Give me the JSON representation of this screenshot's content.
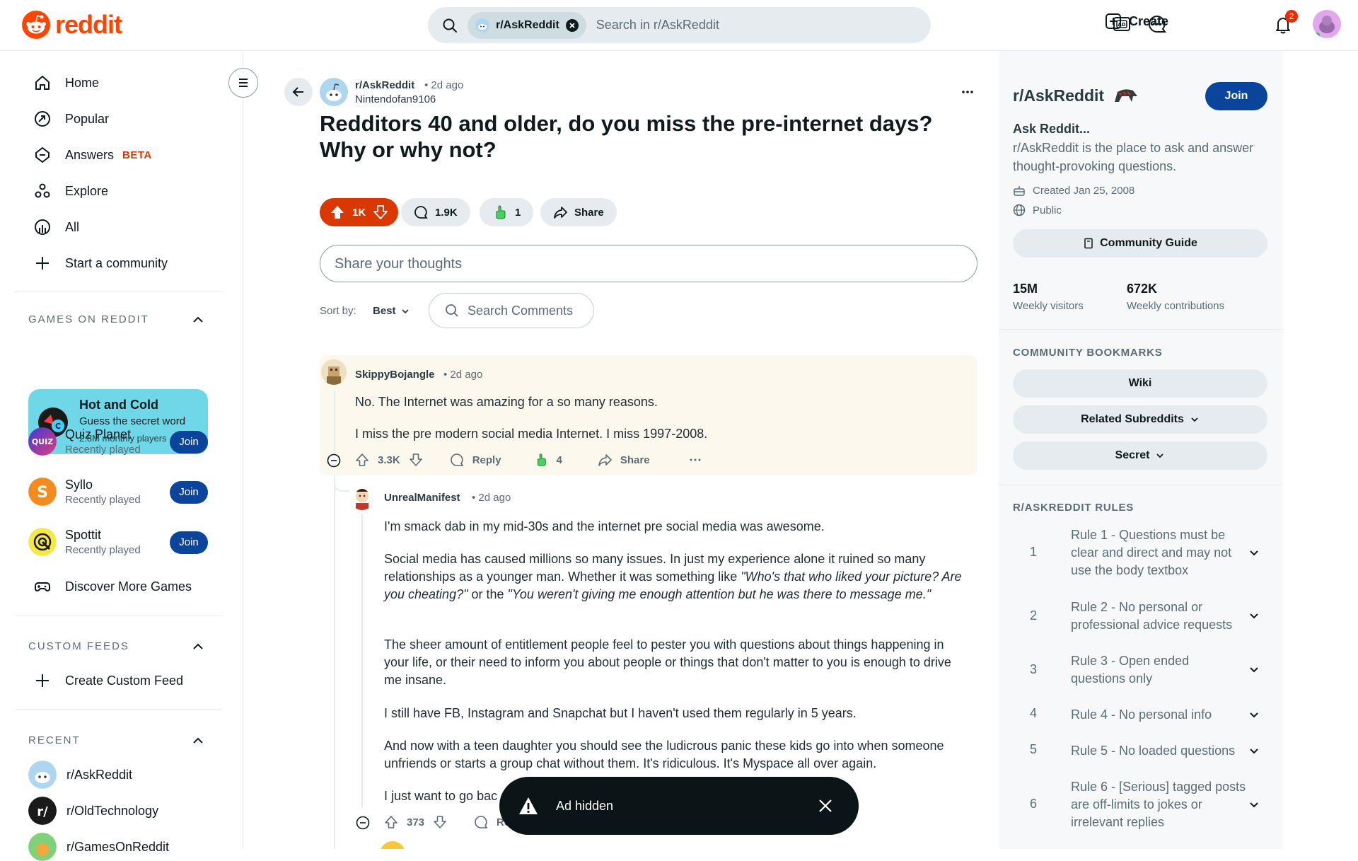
{
  "header": {
    "logo_text": "reddit",
    "search_chip": "r/AskReddit",
    "search_placeholder": "Search in r/AskReddit",
    "create_label": "Create",
    "notification_count": "2"
  },
  "left_nav": {
    "items": [
      {
        "label": "Home",
        "icon": "home-icon"
      },
      {
        "label": "Popular",
        "icon": "popular-icon"
      },
      {
        "label": "Answers",
        "icon": "answers-icon",
        "badge": "BETA"
      },
      {
        "label": "Explore",
        "icon": "explore-icon"
      },
      {
        "label": "All",
        "icon": "all-icon"
      },
      {
        "label": "Start a community",
        "icon": "plus-icon"
      }
    ],
    "games_section": "GAMES ON REDDIT",
    "featured_game": {
      "name": "Hot and Cold",
      "tagline": "Guess the secret word",
      "players": "2.8M monthly players"
    },
    "games": [
      {
        "name": "Quiz Planet",
        "sub": "Recently played",
        "join": "Join"
      },
      {
        "name": "Syllo",
        "sub": "Recently played",
        "join": "Join"
      },
      {
        "name": "Spottit",
        "sub": "Recently played",
        "join": "Join"
      }
    ],
    "discover_games": "Discover More Games",
    "custom_feeds_section": "CUSTOM FEEDS",
    "create_custom_feed": "Create Custom Feed",
    "recent_section": "RECENT",
    "recent": [
      "r/AskReddit",
      "r/OldTechnology",
      "r/GamesOnReddit"
    ]
  },
  "post": {
    "subreddit": "r/AskReddit",
    "time": "2d ago",
    "author": "Nintendofan9106",
    "title": "Redditors 40 and older, do you miss the pre-internet days? Why or why not?",
    "votes": "1K",
    "comments": "1.9K",
    "awards": "1",
    "share": "Share"
  },
  "comment_box": {
    "placeholder": "Share your thoughts"
  },
  "sort": {
    "label": "Sort by:",
    "value": "Best",
    "search_comments": "Search Comments"
  },
  "comments": [
    {
      "user": "SkippyBojangle",
      "time": "2d ago",
      "paragraphs": [
        "No. The Internet was amazing for a so many reasons.",
        "I miss the pre modern social media Internet. I miss 1997-2008."
      ],
      "votes": "3.3K",
      "reply": "Reply",
      "awards": "4",
      "share": "Share"
    },
    {
      "user": "UnrealManifest",
      "time": "2d ago",
      "p1": "I'm smack dab in my mid-30s and the internet pre social media was awesome.",
      "p2a": "Social media has caused millions so many issues. In just my experience alone it ruined so many relationships as a younger man. Whether it was something like ",
      "p2b": "\"Who's that who liked your picture? Are you cheating?\"",
      "p2c": " or the ",
      "p2d": "\"You weren't giving me enough attention but he was there to message me.\"",
      "p3": "The sheer amount of entitlement people feel to pester you with questions about things happening in your life, or their need to inform you about people or things that don't matter to you is enough to drive me insane.",
      "p4": "I still have FB, Instagram and Snapchat but I haven't used them regularly in 5 years.",
      "p5": "And now with a teen daughter you should see the ludicrous panic these kids go into when someone unfriends or starts a group chat without them. It's ridiculous. It's Myspace all over again.",
      "p6": "I just want to go bac",
      "votes": "373",
      "reply": "Rep"
    }
  ],
  "toast": {
    "text": "Ad hidden"
  },
  "sidebar": {
    "name": "r/AskReddit",
    "join": "Join",
    "heading": "Ask Reddit...",
    "description": "r/AskReddit is the place to ask and answer thought-provoking questions.",
    "created": "Created Jan 25, 2008",
    "visibility": "Public",
    "guide": "Community Guide",
    "stats": [
      {
        "value": "15M",
        "label": "Weekly visitors"
      },
      {
        "value": "672K",
        "label": "Weekly contributions"
      }
    ],
    "bookmarks_section": "COMMUNITY BOOKMARKS",
    "bookmarks": [
      "Wiki",
      "Related Subreddits",
      "Secret"
    ],
    "rules_section": "R/ASKREDDIT RULES",
    "rules": [
      {
        "num": "1",
        "text": "Rule 1 - Questions must be clear and direct and may not use the body textbox"
      },
      {
        "num": "2",
        "text": "Rule 2 - No personal or professional advice requests"
      },
      {
        "num": "3",
        "text": "Rule 3 - Open ended questions only"
      },
      {
        "num": "4",
        "text": "Rule 4 - No personal info"
      },
      {
        "num": "5",
        "text": "Rule 5 - No loaded questions"
      },
      {
        "num": "6",
        "text": "Rule 6 - [Serious] tagged posts are off-limits to jokes or irrelevant replies"
      }
    ]
  },
  "colors": {
    "brand": "#ff4500",
    "join": "#0a449b",
    "upvote_active": "#d93900"
  }
}
